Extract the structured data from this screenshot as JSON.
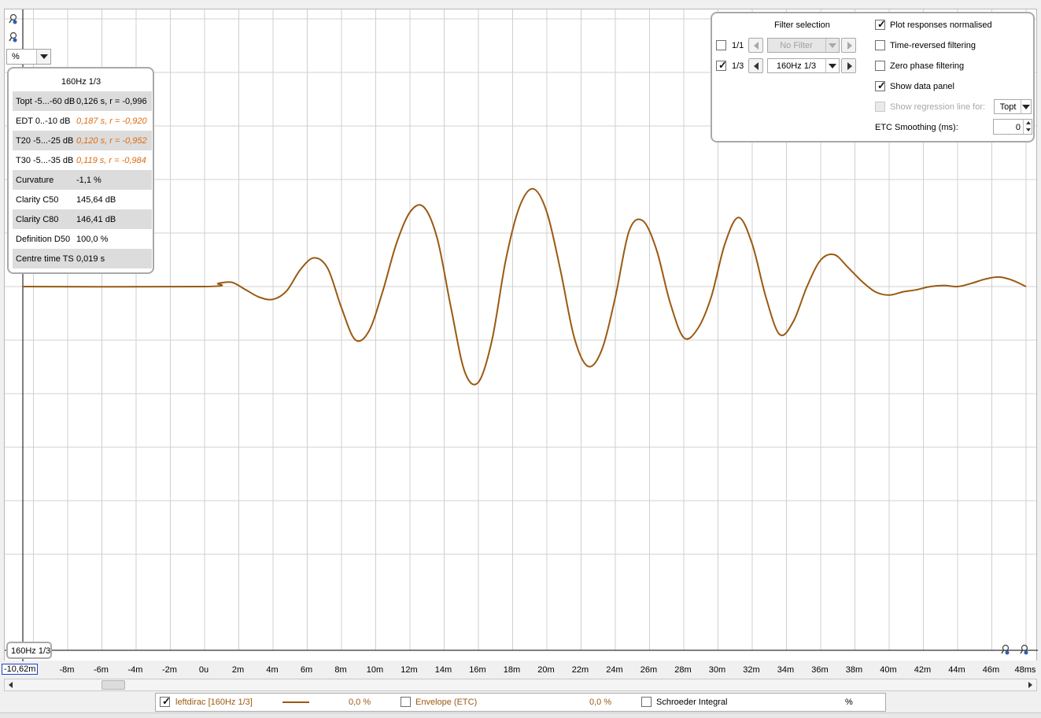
{
  "unit_selector": {
    "value": "%"
  },
  "data_panel": {
    "title": "160Hz 1/3",
    "rows": [
      {
        "label": "Topt -5...-60 dB",
        "value": "0,126 s,  r = -0,996",
        "orange": false
      },
      {
        "label": "EDT  0..-10 dB",
        "value": "0,187 s, r = -0,920",
        "orange": true
      },
      {
        "label": "T20 -5...-25 dB",
        "value": "0,120 s, r = -0,952",
        "orange": true
      },
      {
        "label": "T30 -5...-35 dB",
        "value": "0,119 s, r = -0,984",
        "orange": true
      },
      {
        "label": "Curvature",
        "value": "-1,1 %",
        "orange": false
      },
      {
        "label": "Clarity C50",
        "value": "145,64 dB",
        "orange": false
      },
      {
        "label": "Clarity C80",
        "value": "146,41 dB",
        "orange": false
      },
      {
        "label": "Definition D50",
        "value": "100,0 %",
        "orange": false
      },
      {
        "label": "Centre time TS",
        "value": "0,019 s",
        "orange": false
      }
    ]
  },
  "filter_panel": {
    "title": "Filter selection",
    "octave_1_1": {
      "label": "1/1",
      "checked": false,
      "filter": "No Filter"
    },
    "octave_1_3": {
      "label": "1/3",
      "checked": true,
      "filter": "160Hz 1/3"
    },
    "options": {
      "plot_normalised": {
        "label": "Plot responses normalised",
        "checked": true
      },
      "time_reversed": {
        "label": "Time-reversed filtering",
        "checked": false
      },
      "zero_phase": {
        "label": "Zero phase filtering",
        "checked": false
      },
      "show_data_panel": {
        "label": "Show data panel",
        "checked": true
      },
      "show_regression": {
        "label": "Show regression line for:",
        "checked": false,
        "value": "Topt"
      }
    },
    "etc_smoothing": {
      "label": "ETC Smoothing (ms):",
      "value": "0"
    }
  },
  "curve_badge": "160Hz 1/3",
  "x_axis": {
    "start_value": "-10,62m",
    "ticks": [
      "-8m",
      "-6m",
      "-4m",
      "-2m",
      "0u",
      "2m",
      "4m",
      "6m",
      "8m",
      "10m",
      "12m",
      "14m",
      "16m",
      "18m",
      "20m",
      "22m",
      "24m",
      "26m",
      "28m",
      "30m",
      "32m",
      "34m",
      "36m",
      "38m",
      "40m",
      "42m",
      "44m",
      "46m",
      "48ms"
    ]
  },
  "legend": {
    "items": [
      {
        "label": "leftdirac [160Hz 1/3]",
        "checked": true,
        "value": "0,0 %",
        "color": "#9a5a12"
      },
      {
        "label": "Envelope (ETC)",
        "checked": false,
        "value": "0,0 %",
        "color": "#9a5a12"
      },
      {
        "label": "Schroeder Integral",
        "checked": false,
        "value": "%",
        "color": "#000000"
      }
    ]
  },
  "colors": {
    "curve": "#9a5a12",
    "orange_value": "#e06a10",
    "grid": "#d0d0d0"
  },
  "chart_data": {
    "type": "line",
    "xlabel": "",
    "ylabel": "",
    "x_unit": "ms",
    "xlim": [
      -10.62,
      48
    ],
    "ylim": [
      -100,
      100
    ],
    "series": [
      {
        "name": "leftdirac [160Hz 1/3]",
        "x": [
          -10.62,
          0,
          0.8,
          1.6,
          2.4,
          3.2,
          4.0,
          4.8,
          5.6,
          6.4,
          7.2,
          8.0,
          8.8,
          9.6,
          10.4,
          11.2,
          12.0,
          12.8,
          13.6,
          14.4,
          15.2,
          16.0,
          16.8,
          17.6,
          18.4,
          19.2,
          20.0,
          20.8,
          21.6,
          22.4,
          23.2,
          24.0,
          24.8,
          25.6,
          26.4,
          27.2,
          28.0,
          28.8,
          29.6,
          30.4,
          31.2,
          32.0,
          32.8,
          33.6,
          34.4,
          35.2,
          36.0,
          36.8,
          37.6,
          38.4,
          39.2,
          40.0,
          40.8,
          41.6,
          42.4,
          43.2,
          44.0,
          44.8,
          45.6,
          46.4,
          47.2,
          48.0
        ],
        "y": [
          0,
          0,
          3,
          4,
          -3,
          -10,
          -12,
          -4,
          16,
          27,
          17,
          -20,
          -50,
          -42,
          -5,
          40,
          70,
          75,
          45,
          -20,
          -80,
          -90,
          -50,
          25,
          75,
          92,
          70,
          15,
          -48,
          -75,
          -60,
          -10,
          52,
          62,
          35,
          -15,
          -48,
          -40,
          -10,
          40,
          65,
          40,
          -10,
          -45,
          -33,
          0,
          25,
          30,
          18,
          5,
          -5,
          -8,
          -5,
          -3,
          0,
          1,
          0,
          3,
          7,
          9,
          6,
          0
        ]
      }
    ]
  }
}
